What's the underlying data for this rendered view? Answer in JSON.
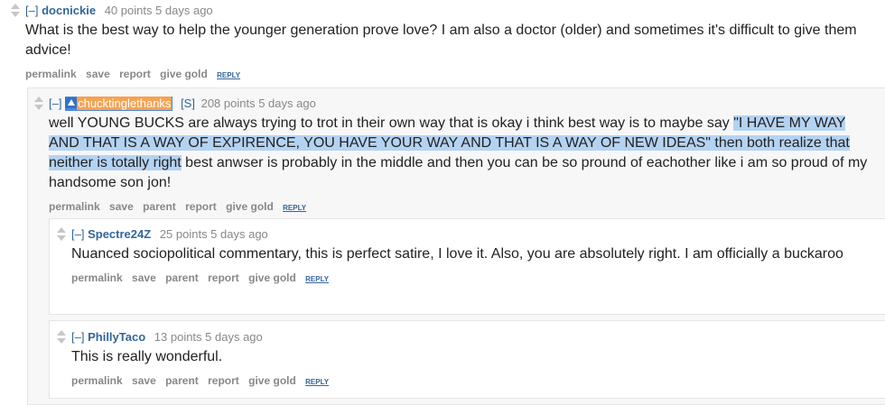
{
  "comments": [
    {
      "collapse": "[–]",
      "author": "docnickie",
      "score": "40 points 5 days ago",
      "body": "What is the best way to help the younger generation prove love? I am also a doctor (older) and sometimes it's difficult to give them advice!",
      "buttons": [
        "permalink",
        "save",
        "report",
        "give gold"
      ],
      "reply": "REPLY"
    },
    {
      "collapse": "[–]",
      "author": "chucktinglethanks",
      "flag": "[S]",
      "score": "208 points 5 days ago",
      "body_before": "well YOUNG BUCKS are always trying to trot in their own way that is okay i think best way is to maybe say ",
      "body_highlight": "\"I HAVE MY WAY AND THAT IS A WAY OF EXPIRENCE, YOU HAVE YOUR WAY AND THAT IS A WAY OF NEW IDEAS\" then both realize that neither is totally right",
      "body_after": " best anwser is probably in the middle and then you can be so pround of eachother like i am so proud of my handsome son jon!",
      "buttons": [
        "permalink",
        "save",
        "parent",
        "report",
        "give gold"
      ],
      "reply": "REPLY"
    },
    {
      "collapse": "[–]",
      "author": "Spectre24Z",
      "score": "25 points 5 days ago",
      "body": "Nuanced sociopolitical commentary, this is perfect satire, I love it. Also, you are absolutely right. I am officially a buckaroo",
      "buttons": [
        "permalink",
        "save",
        "parent",
        "report",
        "give gold"
      ],
      "reply": "REPLY"
    },
    {
      "collapse": "[–]",
      "author": "PhillyTaco",
      "score": "13 points 5 days ago",
      "body": "This is really wonderful.",
      "buttons": [
        "permalink",
        "save",
        "parent",
        "report",
        "give gold"
      ],
      "reply": "REPLY"
    }
  ],
  "colors": {
    "link": "#336699",
    "muted": "#888888",
    "selection": "#b4d3f2",
    "op_badge": "#f5a354",
    "op_highlight": "#4d8ad6"
  }
}
